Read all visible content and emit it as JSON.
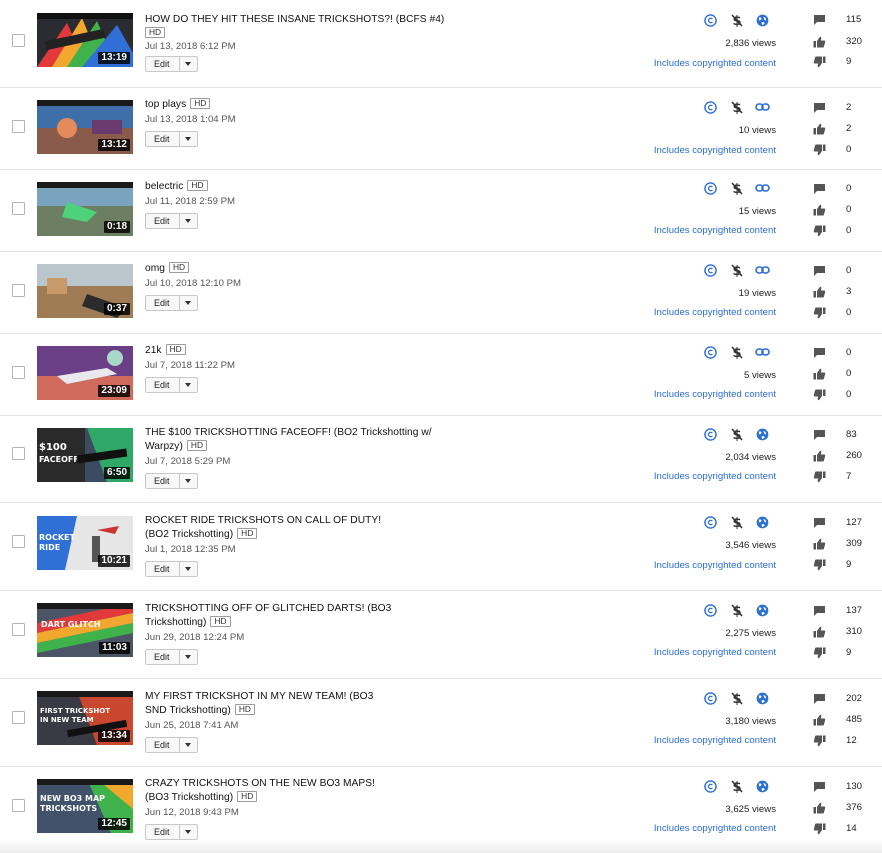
{
  "videos": [
    {
      "title": "HOW DO THEY HIT THESE INSANE TRICKSHOTS?! (BCFS #4)",
      "hd": "HD",
      "date": "Jul 13, 2018 6:12 PM",
      "duration": "13:19",
      "edit_label": "Edit",
      "visibility_icon": "globe-icon",
      "views": "2,836 views",
      "copyright": "Includes copyrighted content",
      "comments": "115",
      "likes": "320",
      "dislikes": "9"
    },
    {
      "title": "top plays",
      "hd": "HD",
      "date": "Jul 13, 2018 1:04 PM",
      "duration": "13:12",
      "edit_label": "Edit",
      "visibility_icon": "link-icon",
      "views": "10 views",
      "copyright": "Includes copyrighted content",
      "comments": "2",
      "likes": "2",
      "dislikes": "0"
    },
    {
      "title": "belectric",
      "hd": "HD",
      "date": "Jul 11, 2018 2:59 PM",
      "duration": "0:18",
      "edit_label": "Edit",
      "visibility_icon": "link-icon",
      "views": "15 views",
      "copyright": "Includes copyrighted content",
      "comments": "0",
      "likes": "0",
      "dislikes": "0"
    },
    {
      "title": "omg",
      "hd": "HD",
      "date": "Jul 10, 2018 12:10 PM",
      "duration": "0:37",
      "edit_label": "Edit",
      "visibility_icon": "link-icon",
      "views": "19 views",
      "copyright": "Includes copyrighted content",
      "comments": "0",
      "likes": "3",
      "dislikes": "0"
    },
    {
      "title": "21k",
      "hd": "HD",
      "date": "Jul 7, 2018 11:22 PM",
      "duration": "23:09",
      "edit_label": "Edit",
      "visibility_icon": "link-icon",
      "views": "5 views",
      "copyright": "Includes copyrighted content",
      "comments": "0",
      "likes": "0",
      "dislikes": "0"
    },
    {
      "title": "THE $100 TRICKSHOTTING FACEOFF! (BO2 Trickshotting w/ Warpzy)",
      "hd": "HD",
      "date": "Jul 7, 2018 5:29 PM",
      "duration": "6:50",
      "edit_label": "Edit",
      "visibility_icon": "globe-icon",
      "views": "2,034 views",
      "copyright": "Includes copyrighted content",
      "comments": "83",
      "likes": "260",
      "dislikes": "7"
    },
    {
      "title": "ROCKET RIDE TRICKSHOTS ON CALL OF DUTY! (BO2 Trickshotting)",
      "hd": "HD",
      "date": "Jul 1, 2018 12:35 PM",
      "duration": "10:21",
      "edit_label": "Edit",
      "visibility_icon": "globe-icon",
      "views": "3,546 views",
      "copyright": "Includes copyrighted content",
      "comments": "127",
      "likes": "309",
      "dislikes": "9"
    },
    {
      "title": "TRICKSHOTTING OFF OF GLITCHED DARTS! (BO3 Trickshotting)",
      "hd": "HD",
      "date": "Jun 29, 2018 12:24 PM",
      "duration": "11:03",
      "edit_label": "Edit",
      "visibility_icon": "globe-icon",
      "views": "2,275 views",
      "copyright": "Includes copyrighted content",
      "comments": "137",
      "likes": "310",
      "dislikes": "9"
    },
    {
      "title": "MY FIRST TRICKSHOT IN MY NEW TEAM! (BO3 SND Trickshotting)",
      "hd": "HD",
      "date": "Jun 25, 2018 7:41 AM",
      "duration": "13:34",
      "edit_label": "Edit",
      "visibility_icon": "globe-icon",
      "views": "3,180 views",
      "copyright": "Includes copyrighted content",
      "comments": "202",
      "likes": "485",
      "dislikes": "12"
    },
    {
      "title": "CRAZY TRICKSHOTS ON THE NEW BO3 MAPS! (BO3 Trickshotting)",
      "hd": "HD",
      "date": "Jun 12, 2018 9:43 PM",
      "duration": "12:45",
      "edit_label": "Edit",
      "visibility_icon": "globe-icon",
      "views": "3,625 views",
      "copyright": "Includes copyrighted content",
      "comments": "130",
      "likes": "376",
      "dislikes": "14"
    }
  ],
  "colors": {
    "accent_blue": "#2a6ed6",
    "icon_gray": "#555555"
  }
}
